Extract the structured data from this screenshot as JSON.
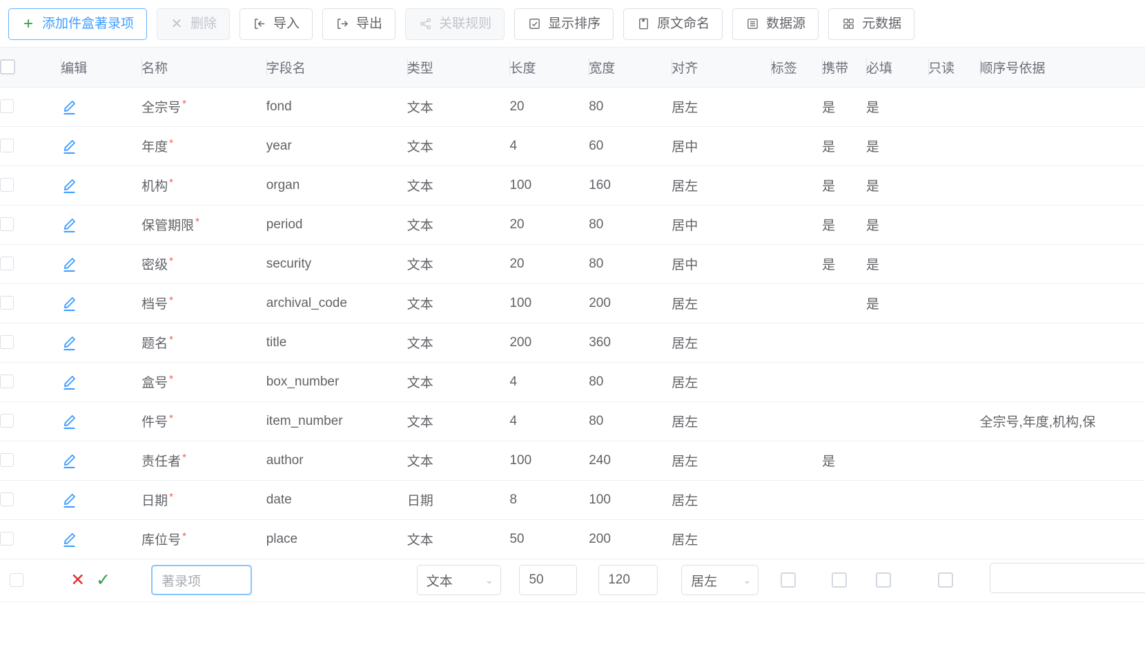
{
  "toolbar": {
    "buttons": [
      {
        "label": "添加件盒著录项",
        "icon": "plus-icon",
        "style": "primary",
        "disabled": false
      },
      {
        "label": "删除",
        "icon": "close-x-icon",
        "style": "danger-ic",
        "disabled": true
      },
      {
        "label": "导入",
        "icon": "import-icon",
        "style": "normal",
        "disabled": false
      },
      {
        "label": "导出",
        "icon": "export-icon",
        "style": "normal",
        "disabled": false
      },
      {
        "label": "关联规则",
        "icon": "share-nodes-icon",
        "style": "normal",
        "disabled": true
      },
      {
        "label": "显示排序",
        "icon": "checkbox-square-icon",
        "style": "normal",
        "disabled": false
      },
      {
        "label": "原文命名",
        "icon": "bookmark-icon",
        "style": "normal",
        "disabled": false
      },
      {
        "label": "数据源",
        "icon": "list-table-icon",
        "style": "normal",
        "disabled": false
      },
      {
        "label": "元数据",
        "icon": "grid-blocks-icon",
        "style": "normal",
        "disabled": false
      }
    ]
  },
  "table": {
    "columns": [
      {
        "key": "select",
        "label": ""
      },
      {
        "key": "edit",
        "label": "编辑"
      },
      {
        "key": "name",
        "label": "名称"
      },
      {
        "key": "field",
        "label": "字段名"
      },
      {
        "key": "type",
        "label": "类型"
      },
      {
        "key": "length",
        "label": "长度"
      },
      {
        "key": "width",
        "label": "宽度"
      },
      {
        "key": "align",
        "label": "对齐"
      },
      {
        "key": "tag",
        "label": "标签"
      },
      {
        "key": "carry",
        "label": "携带"
      },
      {
        "key": "required",
        "label": "必填"
      },
      {
        "key": "readonly",
        "label": "只读"
      },
      {
        "key": "seq",
        "label": "顺序号依据"
      }
    ],
    "rows": [
      {
        "name": "全宗号",
        "required_mark": "*",
        "field": "fond",
        "type": "文本",
        "length": "20",
        "width": "80",
        "align": "居左",
        "tag": "",
        "carry": "是",
        "required": "是",
        "readonly": "",
        "seq": ""
      },
      {
        "name": "年度",
        "required_mark": "*",
        "field": "year",
        "type": "文本",
        "length": "4",
        "width": "60",
        "align": "居中",
        "tag": "",
        "carry": "是",
        "required": "是",
        "readonly": "",
        "seq": ""
      },
      {
        "name": "机构",
        "required_mark": "*",
        "field": "organ",
        "type": "文本",
        "length": "100",
        "width": "160",
        "align": "居左",
        "tag": "",
        "carry": "是",
        "required": "是",
        "readonly": "",
        "seq": ""
      },
      {
        "name": "保管期限",
        "required_mark": "*",
        "field": "period",
        "type": "文本",
        "length": "20",
        "width": "80",
        "align": "居中",
        "tag": "",
        "carry": "是",
        "required": "是",
        "readonly": "",
        "seq": ""
      },
      {
        "name": "密级",
        "required_mark": "*",
        "field": "security",
        "type": "文本",
        "length": "20",
        "width": "80",
        "align": "居中",
        "tag": "",
        "carry": "是",
        "required": "是",
        "readonly": "",
        "seq": ""
      },
      {
        "name": "档号",
        "required_mark": "*",
        "field": "archival_code",
        "type": "文本",
        "length": "100",
        "width": "200",
        "align": "居左",
        "tag": "",
        "carry": "",
        "required": "是",
        "readonly": "",
        "seq": ""
      },
      {
        "name": "题名",
        "required_mark": "*",
        "field": "title",
        "type": "文本",
        "length": "200",
        "width": "360",
        "align": "居左",
        "tag": "",
        "carry": "",
        "required": "",
        "readonly": "",
        "seq": ""
      },
      {
        "name": "盒号",
        "required_mark": "*",
        "field": "box_number",
        "type": "文本",
        "length": "4",
        "width": "80",
        "align": "居左",
        "tag": "",
        "carry": "",
        "required": "",
        "readonly": "",
        "seq": ""
      },
      {
        "name": "件号",
        "required_mark": "*",
        "field": "item_number",
        "type": "文本",
        "length": "4",
        "width": "80",
        "align": "居左",
        "tag": "",
        "carry": "",
        "required": "",
        "readonly": "",
        "seq": "全宗号,年度,机构,保"
      },
      {
        "name": "责任者",
        "required_mark": "*",
        "field": "author",
        "type": "文本",
        "length": "100",
        "width": "240",
        "align": "居左",
        "tag": "",
        "carry": "是",
        "required": "",
        "readonly": "",
        "seq": ""
      },
      {
        "name": "日期",
        "required_mark": "*",
        "field": "date",
        "type": "日期",
        "length": "8",
        "width": "100",
        "align": "居左",
        "tag": "",
        "carry": "",
        "required": "",
        "readonly": "",
        "seq": ""
      },
      {
        "name": "库位号",
        "required_mark": "*",
        "field": "place",
        "type": "文本",
        "length": "50",
        "width": "200",
        "align": "居左",
        "tag": "",
        "carry": "",
        "required": "",
        "readonly": "",
        "seq": ""
      }
    ],
    "editing_row": {
      "cancel_label": "✕",
      "confirm_label": "✓",
      "name_value": "",
      "name_placeholder": "著录项",
      "field_value": "",
      "type_value": "文本",
      "length_value": "50",
      "width_value": "120",
      "align_value": "居左",
      "tag_checked": false,
      "carry_checked": false,
      "required_checked": false,
      "readonly_checked": false,
      "seq_value": ""
    }
  },
  "colors": {
    "accent": "#409eff",
    "danger": "#e03131",
    "success": "#2f9e44",
    "required_star": "#f25c54",
    "header_bg": "#f8f9fb",
    "border": "#ebeef5"
  }
}
